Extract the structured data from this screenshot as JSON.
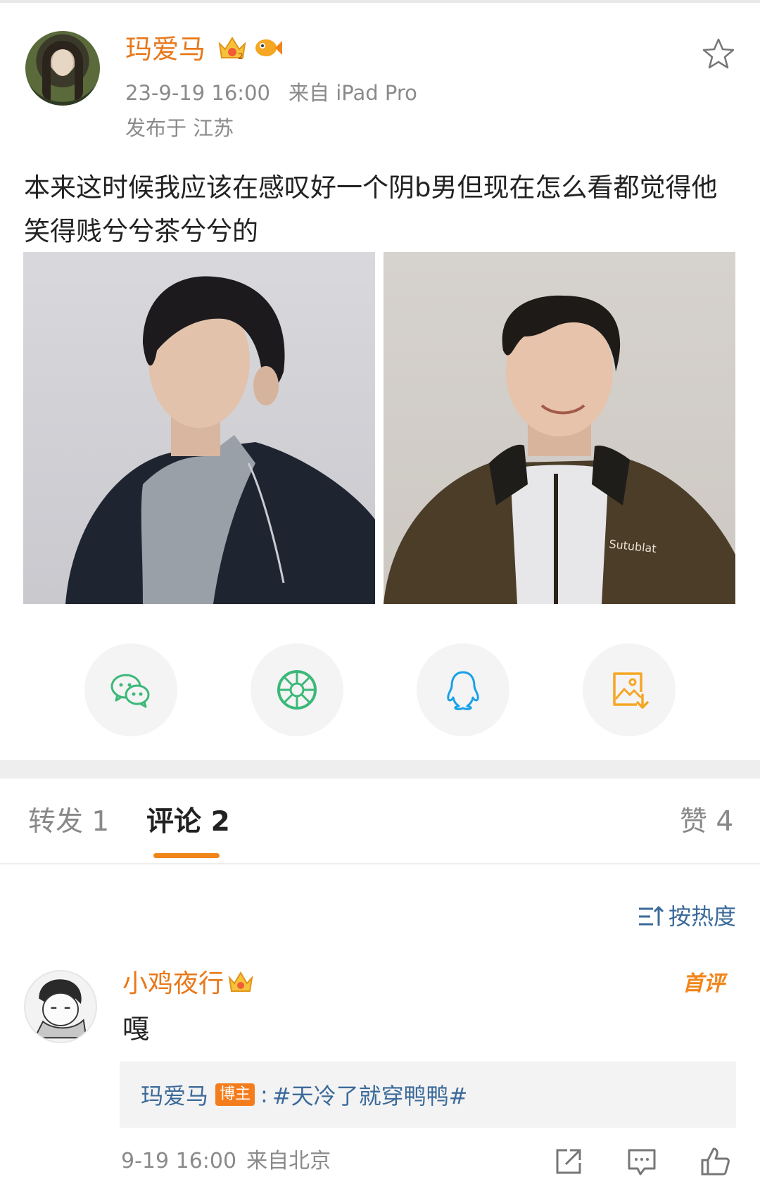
{
  "post": {
    "author": "玛爱马",
    "timestamp": "23-9-19 16:00",
    "source": "来自 iPad Pro",
    "location": "发布于 江苏",
    "text": "本来这时候我应该在感叹好一个阴b男但现在怎么看都觉得他笑得贱兮兮茶兮兮的",
    "icons": [
      "crown-badge-icon",
      "fish-badge-icon",
      "star-icon"
    ]
  },
  "share": {
    "items": [
      {
        "icon": "wechat-icon",
        "color": "#3cb878"
      },
      {
        "icon": "moments-icon",
        "color": "#3cb878"
      },
      {
        "icon": "qq-icon",
        "color": "#1aa0e8"
      },
      {
        "icon": "save-image-icon",
        "color": "#f5a623"
      }
    ]
  },
  "tabs": {
    "repost": "转发 1",
    "comment": "评论 2",
    "like": "赞 4",
    "active": "comment"
  },
  "sort": {
    "label": "按热度"
  },
  "comment": {
    "author": "小鸡夜行",
    "first_badge": "首评",
    "text": "嘎",
    "reply": {
      "user": "玛爱马",
      "badge": "博主",
      "colon": ":",
      "text": "#天冷了就穿鸭鸭#"
    },
    "date": "9-19 16:00",
    "source": "来自北京"
  },
  "colors": {
    "accent": "#f08519",
    "username": "#e8781a",
    "link": "#3b6a9a"
  }
}
